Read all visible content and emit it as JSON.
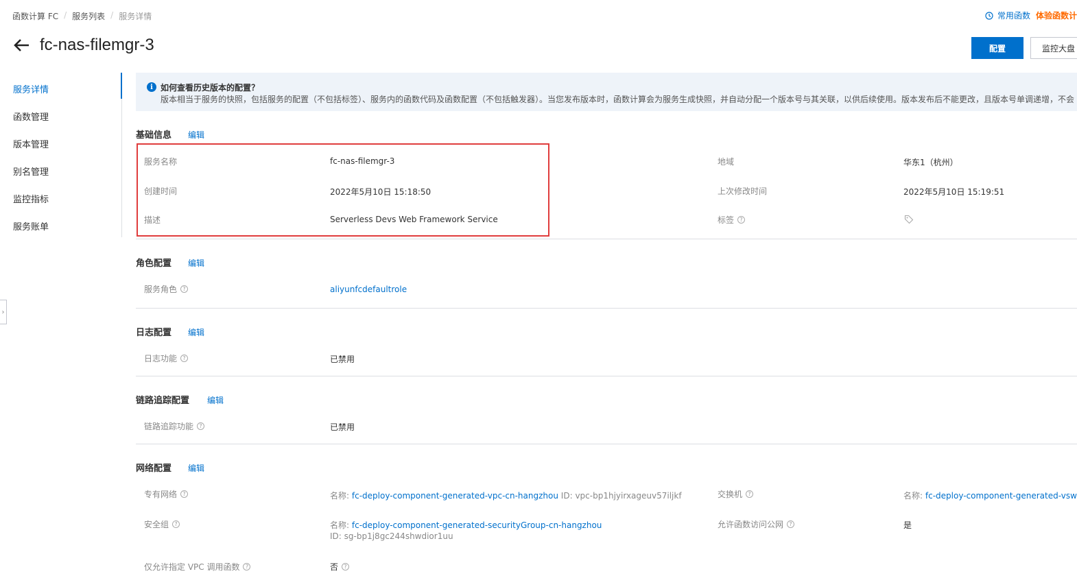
{
  "breadcrumb": [
    "函数计算 FC",
    "服务列表",
    "服务详情"
  ],
  "topbar": {
    "frequent": "常用函数",
    "trial": "体验函数计"
  },
  "header": {
    "title": "fc-nas-filemgr-3",
    "config_button": "配置",
    "dashboard_button": "监控大盘"
  },
  "sidebar": {
    "items": [
      {
        "label": "服务详情",
        "active": true
      },
      {
        "label": "函数管理"
      },
      {
        "label": "版本管理"
      },
      {
        "label": "别名管理"
      },
      {
        "label": "监控指标"
      },
      {
        "label": "服务账单"
      }
    ]
  },
  "notice": {
    "title": "如何查看历史版本的配置？",
    "body": "版本相当于服务的快照，包括服务的配置（不包括标签）、服务内的函数代码及函数配置（不包括触发器）。当您发布版本时，函数计算会为服务生成快照，并自动分配一个版本号与其关联，以供后续使用。版本发布后不能更改，且版本号单调递增，不会"
  },
  "edit_label": "编辑",
  "basic": {
    "title": "基础信息",
    "service_name_label": "服务名称",
    "service_name": "fc-nas-filemgr-3",
    "region_label": "地域",
    "region": "华东1（杭州）",
    "created_label": "创建时间",
    "created": "2022年5月10日 15:18:50",
    "modified_label": "上次修改时间",
    "modified": "2022年5月10日 15:19:51",
    "desc_label": "描述",
    "desc": "Serverless Devs Web Framework Service",
    "tags_label": "标签"
  },
  "role": {
    "title": "角色配置",
    "label": "服务角色",
    "value": "aliyunfcdefaultrole"
  },
  "log": {
    "title": "日志配置",
    "label": "日志功能",
    "value": "已禁用"
  },
  "trace": {
    "title": "链路追踪配置",
    "label": "链路追踪功能",
    "value": "已禁用"
  },
  "network": {
    "title": "网络配置",
    "vpc_label": "专有网络",
    "name_prefix": "名称:",
    "id_prefix": "ID:",
    "vpc_name": "fc-deploy-component-generated-vpc-cn-hangzhou",
    "vpc_id": "vpc-bp1hjyirxageuv57iljkf",
    "vswitch_label": "交换机",
    "vswitch_name": "fc-deploy-component-generated-vswitch-",
    "sg_label": "安全组",
    "sg_name": "fc-deploy-component-generated-securityGroup-cn-hangzhou",
    "sg_id": "sg-bp1j8gc244shwdior1uu",
    "internet_label": "允许函数访问公网",
    "internet_value": "是",
    "vpc_only_label": "仅允许指定 VPC 调用函数",
    "vpc_only_value": "否"
  }
}
